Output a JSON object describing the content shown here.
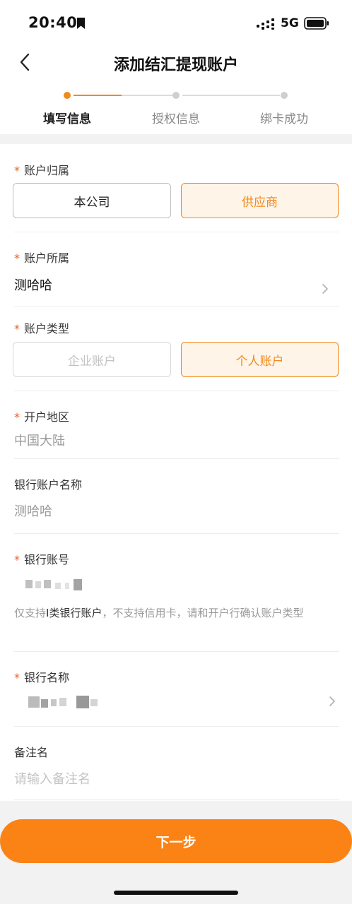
{
  "status_bar": {
    "time": "20:40",
    "network": "5G"
  },
  "nav": {
    "title": "添加结汇提现账户",
    "back_icon": "chevron-left-icon"
  },
  "steps": [
    {
      "label": "填写信息",
      "active": true
    },
    {
      "label": "授权信息",
      "active": false
    },
    {
      "label": "绑卡成功",
      "active": false
    }
  ],
  "form": {
    "account_owner": {
      "required_mark": "*",
      "label": "账户归属",
      "options": [
        "本公司",
        "供应商"
      ],
      "selected": "供应商"
    },
    "account_belongs": {
      "required_mark": "*",
      "label": "账户所属",
      "value": "测哈哈"
    },
    "account_type": {
      "required_mark": "*",
      "label": "账户类型",
      "options": [
        "企业账户",
        "个人账户"
      ],
      "selected": "个人账户",
      "disabled": "企业账户"
    },
    "region": {
      "required_mark": "*",
      "label": "开户地区",
      "value": "中国大陆"
    },
    "bank_account_name": {
      "label": "银行账户名称",
      "value": "测哈哈"
    },
    "bank_account_number": {
      "required_mark": "*",
      "label": "银行账号",
      "hint_prefix": "仅支持",
      "hint_bold": "I类银行账户",
      "hint_suffix": "，不支持信用卡，请和开户行确认账户类型"
    },
    "bank_name": {
      "required_mark": "*",
      "label": "银行名称"
    },
    "remark": {
      "label": "备注名",
      "placeholder": "请输入备注名"
    }
  },
  "footer": {
    "next_label": "下一步"
  },
  "colors": {
    "accent": "#fb8316",
    "required": "#e8612c",
    "selected_bg": "#fff4e8"
  }
}
